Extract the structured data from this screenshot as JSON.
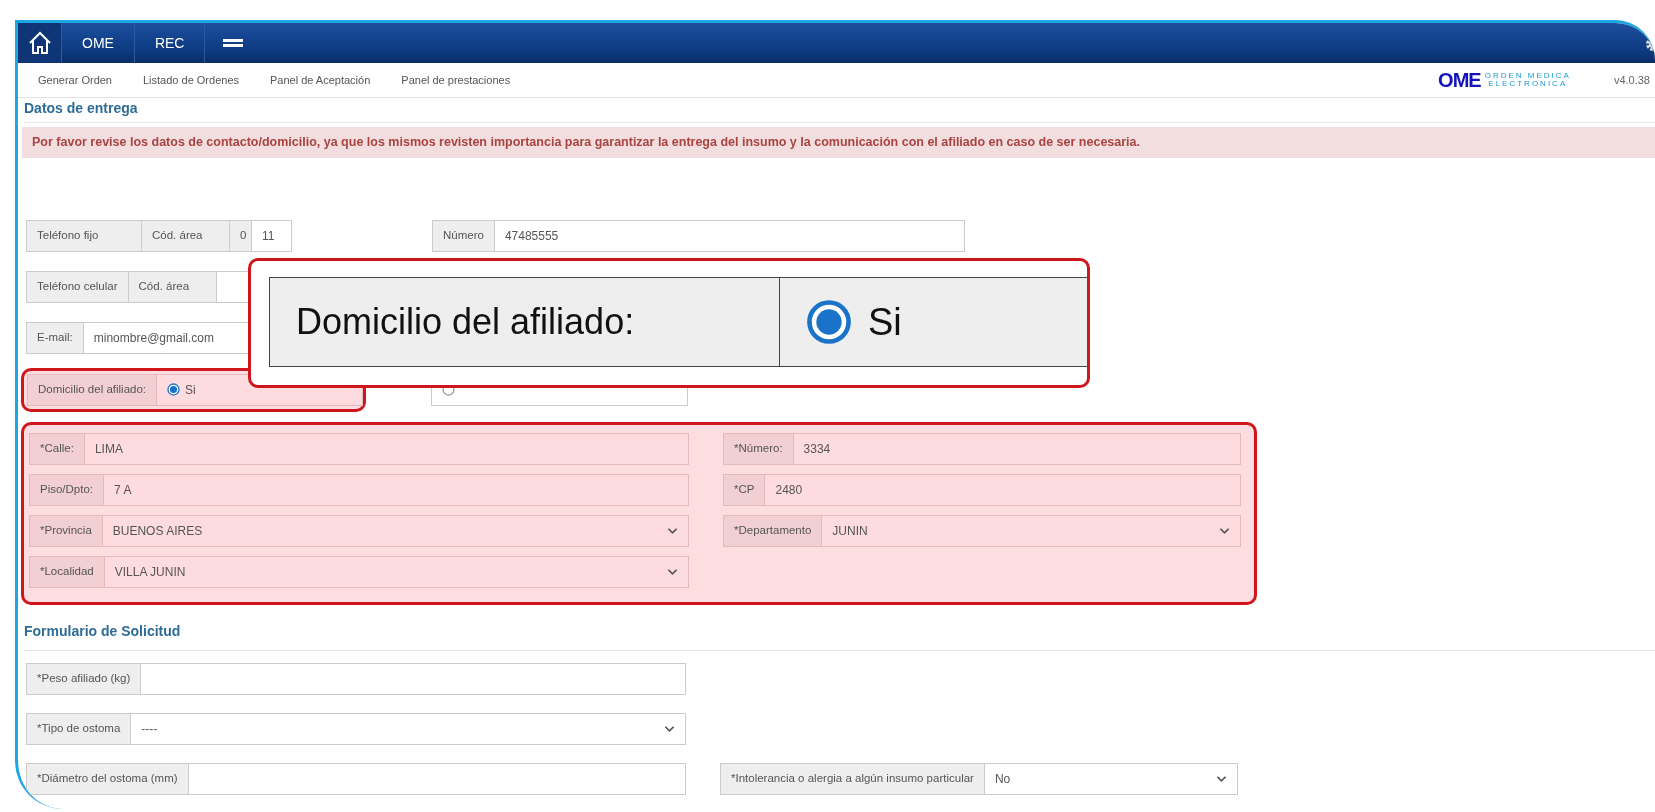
{
  "navbar": {
    "items": [
      "OME",
      "REC"
    ]
  },
  "subnav": [
    "Generar Orden",
    "Listado de Ordenes",
    "Panel de Aceptación",
    "Panel de prestaciones"
  ],
  "logo": {
    "mark": "OME",
    "line_1": "ORDEN MEDICA",
    "line_2": "ELECTRONICA"
  },
  "version": "v4.0.38",
  "delivery": {
    "title": "Datos de entrega",
    "notice": "Por favor revise los datos de contacto/domicilio, ya que los mismos revisten importancia para garantizar la entrega del insumo y la comunicación con el afiliado en caso de ser necesaria.",
    "landline": {
      "label": "Teléfono fijo",
      "area_label": "Cód. área",
      "area_prefix": "0",
      "area_code": "11",
      "number_label": "Número",
      "number": "47485555"
    },
    "mobile": {
      "label": "Teléfono celular",
      "area_label": "Cód. área"
    },
    "email": {
      "label": "E-mail:",
      "value": "minombre@gmail.com"
    },
    "address_choice": {
      "label": "Domicilio del afiliado:",
      "highlighted": true,
      "options": [
        {
          "label": "Si",
          "selected": true
        },
        {
          "selected": false
        }
      ]
    },
    "address": {
      "highlighted": true,
      "fields": [
        {
          "kind": "input",
          "label": "*Calle:",
          "value": "LIMA"
        },
        {
          "kind": "input",
          "label": "*Número:",
          "value": "3334"
        },
        {
          "kind": "input",
          "label": "Piso/Dpto:",
          "value": "7 A"
        },
        {
          "kind": "input",
          "label": "*CP",
          "value": "2480"
        },
        {
          "kind": "select",
          "label": "*Provincia",
          "value": "BUENOS AIRES"
        },
        {
          "kind": "select",
          "label": "*Departamento",
          "value": "JUNIN"
        },
        {
          "kind": "select",
          "label": "*Localidad",
          "value": "VILLA JUNIN"
        }
      ]
    }
  },
  "request_form": {
    "title": "Formulario de Solicitud",
    "rows": [
      [
        {
          "kind": "input",
          "label": "*Peso afiliado (kg)"
        }
      ],
      [
        {
          "kind": "select",
          "label": "*Tipo de ostoma",
          "value": "----"
        }
      ],
      [
        {
          "kind": "input",
          "label": "*Diámetro del ostoma (mm)"
        },
        {
          "kind": "select",
          "label": "*Intolerancia o alergia a algún insumo particular",
          "value": "No"
        }
      ]
    ]
  },
  "callout": {
    "label": "Domicilio del afiliado:",
    "option": {
      "label": "Si",
      "selected": true
    }
  }
}
